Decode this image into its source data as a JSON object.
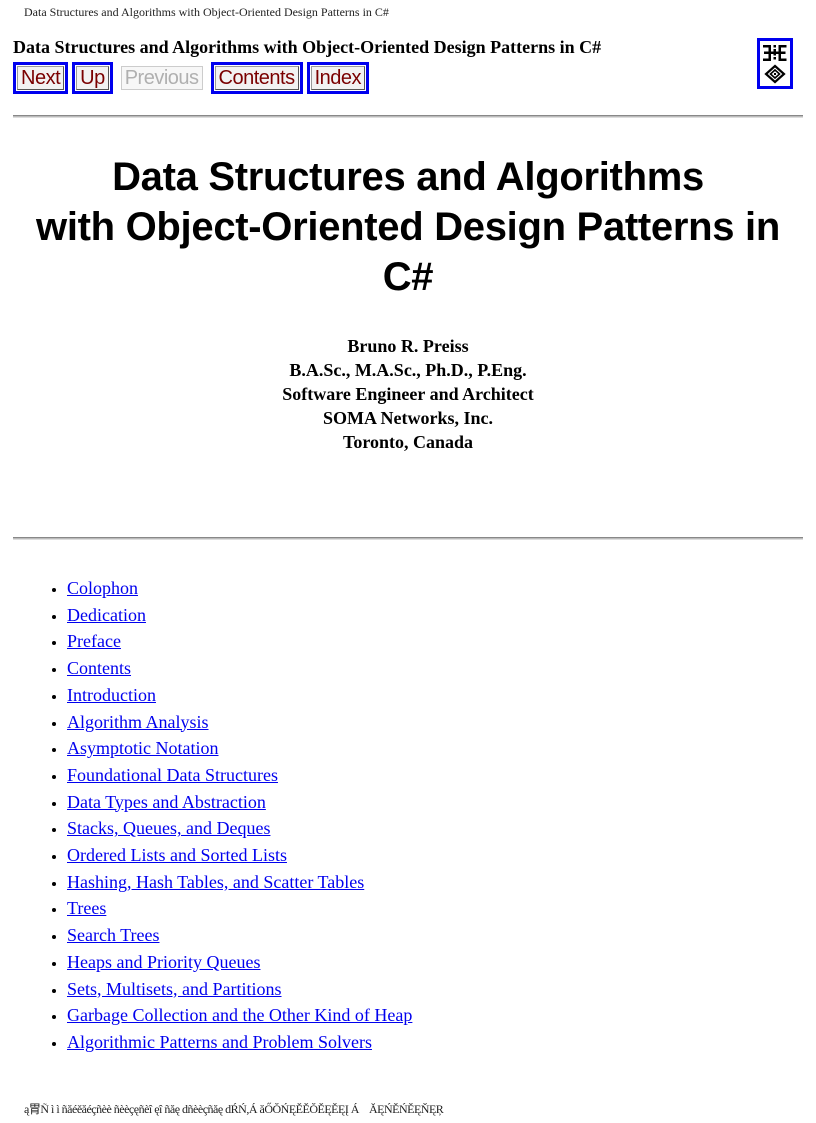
{
  "page_header": {
    "title": "Data Structures and Algorithms with Object-Oriented Design Patterns in C#"
  },
  "navigation": {
    "heading": "Data Structures and Algorithms with Object-Oriented Design Patterns in C#",
    "buttons": [
      {
        "label": "Next",
        "enabled": true
      },
      {
        "label": "Up",
        "enabled": true
      },
      {
        "label": "Previous",
        "enabled": false
      },
      {
        "label": "Contents",
        "enabled": true
      },
      {
        "label": "Index",
        "enabled": true
      }
    ],
    "logo_icon": "book-logo-icon",
    "link_color": "#0000ee",
    "button_text_color": "#7a0000"
  },
  "title_block": {
    "line1": "Data Structures and Algorithms",
    "line2": "with Object-Oriented Design Patterns in",
    "line3": "C#"
  },
  "author": {
    "name": "Bruno R. Preiss",
    "degrees": "B.A.Sc., M.A.Sc., Ph.D., P.Eng.",
    "role": "Software Engineer and Architect",
    "company": "SOMA Networks, Inc.",
    "location": "Toronto, Canada"
  },
  "toc": {
    "items": [
      "Colophon",
      "Dedication",
      "Preface",
      "Contents",
      "Introduction",
      "Algorithm Analysis",
      "Asymptotic Notation",
      "Foundational Data Structures",
      "Data Types and Abstraction",
      "Stacks, Queues, and Deques",
      "Ordered Lists and Sorted Lists",
      "Hashing, Hash Tables, and Scatter Tables",
      "Trees",
      "Search Trees",
      "Heaps and Priority Queues",
      "Sets, Multisets, and Partitions",
      "Garbage Collection and the Other Kind of Heap",
      "Algorithmic Patterns and Problem Solvers"
    ]
  },
  "footer": {
    "text": "ą胃Ñ ì ì ñăéěăéçñèè ñèèçęñèî ęî ñăę dñèèçñăę dŔŃ,Á ăŐŎŃĘĚĚŎĚĘĚĘĮ Á    ĂĘŃĚŃĚĘŇĘŖ"
  }
}
